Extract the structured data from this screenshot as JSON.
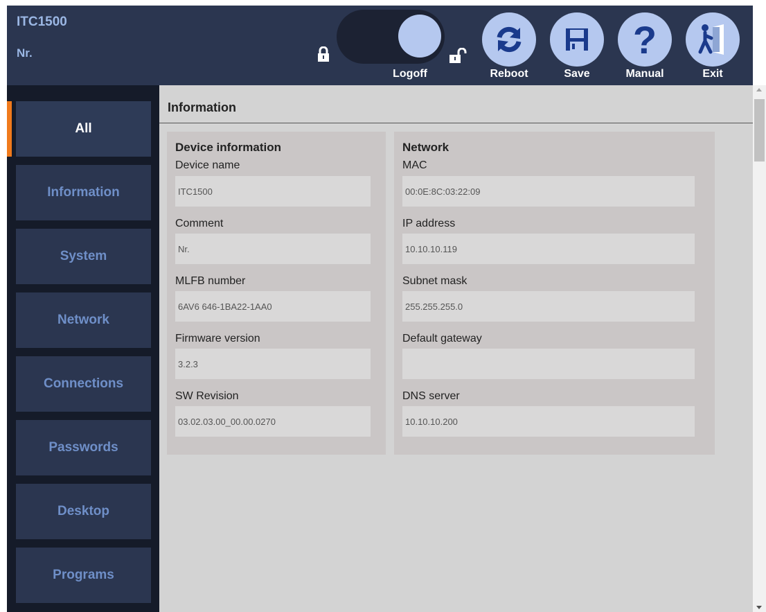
{
  "header": {
    "device_name": "ITC1500",
    "device_comment": "Nr.",
    "logoff_label": "Logoff",
    "buttons": {
      "reboot": "Reboot",
      "save": "Save",
      "manual": "Manual",
      "exit": "Exit"
    },
    "manual_glyph": "?"
  },
  "sidebar": {
    "items": [
      {
        "label": "All",
        "active": true
      },
      {
        "label": "Information",
        "active": false
      },
      {
        "label": "System",
        "active": false
      },
      {
        "label": "Network",
        "active": false
      },
      {
        "label": "Connections",
        "active": false
      },
      {
        "label": "Passwords",
        "active": false
      },
      {
        "label": "Desktop",
        "active": false
      },
      {
        "label": "Programs",
        "active": false
      }
    ]
  },
  "main": {
    "section_title": "Information",
    "device_info": {
      "heading": "Device information",
      "fields": [
        {
          "label": "Device name",
          "value": "ITC1500"
        },
        {
          "label": "Comment",
          "value": "Nr."
        },
        {
          "label": "MLFB number",
          "value": "6AV6 646-1BA22-1AA0"
        },
        {
          "label": "Firmware version",
          "value": "3.2.3"
        },
        {
          "label": "SW Revision",
          "value": "03.02.03.00_00.00.0270"
        }
      ]
    },
    "network": {
      "heading": "Network",
      "fields": [
        {
          "label": "MAC",
          "value": "00:0E:8C:03:22:09"
        },
        {
          "label": "IP address",
          "value": "10.10.10.119"
        },
        {
          "label": "Subnet mask",
          "value": "255.255.255.0"
        },
        {
          "label": "Default gateway",
          "value": ""
        },
        {
          "label": "DNS server",
          "value": "10.10.10.200"
        }
      ]
    }
  },
  "colors": {
    "header_bg": "#2b3650",
    "sidebar_bg": "#151b29",
    "nav_item_bg": "#2b3650",
    "nav_text": "#6f8fc8",
    "accent": "#f07a1c",
    "button_circle": "#b5c8ef",
    "icon_blue": "#1a3a8c",
    "content_bg": "#d3d3d3"
  },
  "icons": {
    "lock_closed": "lock-closed-icon",
    "lock_open": "lock-open-icon",
    "reboot": "refresh-icon",
    "save": "floppy-disk-icon",
    "manual": "question-mark-icon",
    "exit": "exit-door-icon"
  }
}
